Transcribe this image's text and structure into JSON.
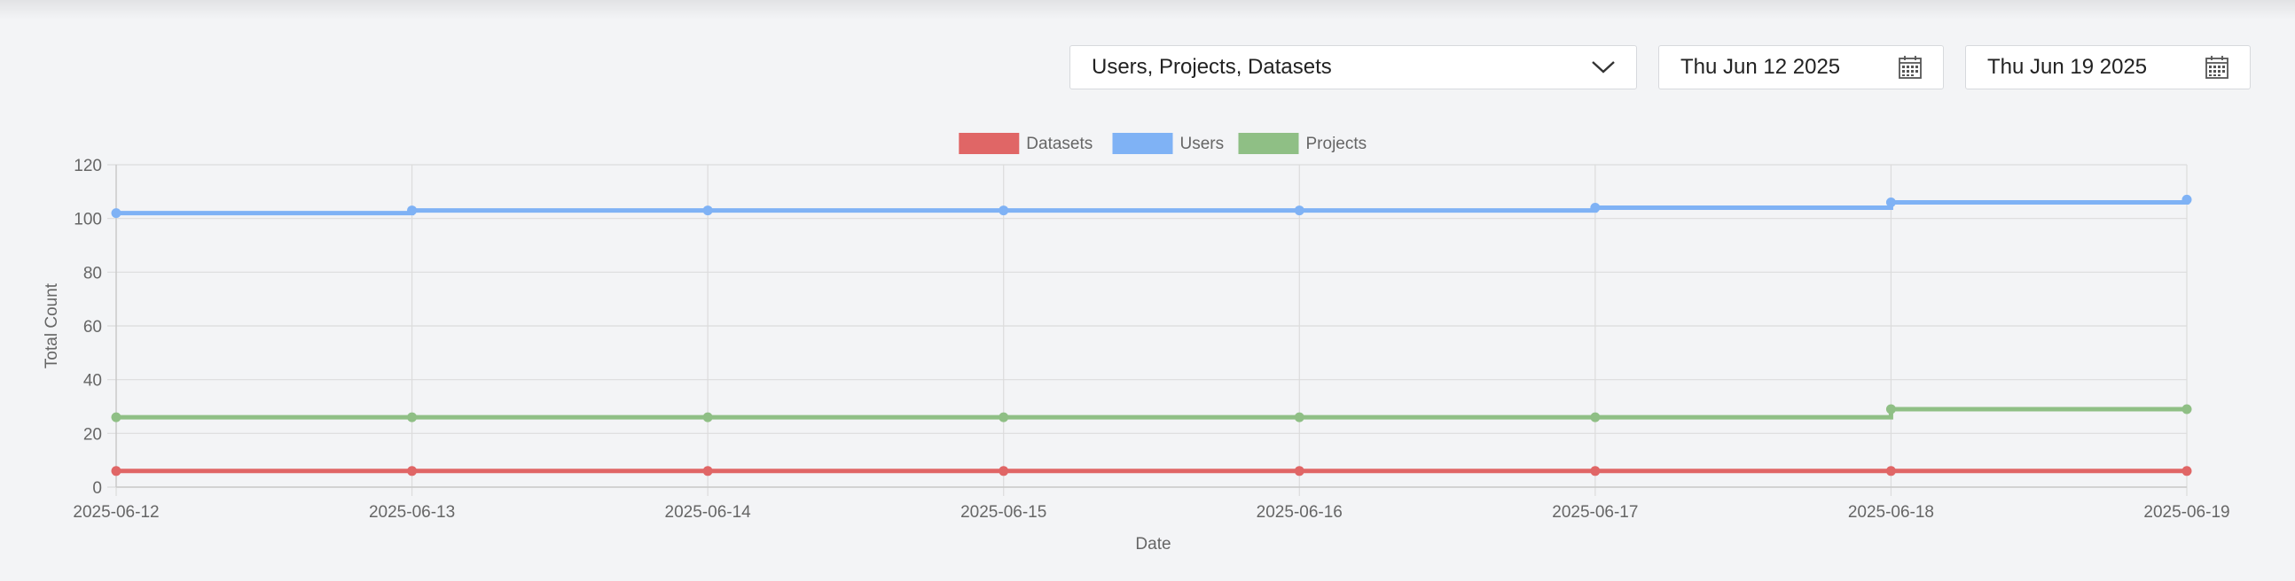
{
  "controls": {
    "series_select": {
      "value": "Users, Projects, Datasets"
    },
    "date_start": {
      "value": "Thu Jun 12 2025"
    },
    "date_end": {
      "value": "Thu Jun 19 2025"
    }
  },
  "chart_data": {
    "type": "line",
    "stepped": true,
    "x": [
      "2025-06-12",
      "2025-06-13",
      "2025-06-14",
      "2025-06-15",
      "2025-06-16",
      "2025-06-17",
      "2025-06-18",
      "2025-06-19"
    ],
    "xlabel": "Date",
    "ylabel": "Total Count",
    "ylim": [
      0,
      120
    ],
    "yticks": [
      0,
      20,
      40,
      60,
      80,
      100,
      120
    ],
    "grid": true,
    "legend_position": "top-center",
    "series": [
      {
        "name": "Datasets",
        "color": "#e06666",
        "values": [
          6,
          6,
          6,
          6,
          6,
          6,
          6,
          6
        ]
      },
      {
        "name": "Users",
        "color": "#7fb2f5",
        "values": [
          102,
          103,
          103,
          103,
          103,
          104,
          106,
          107
        ]
      },
      {
        "name": "Projects",
        "color": "#8fbf85",
        "values": [
          26,
          26,
          26,
          26,
          26,
          26,
          29,
          29
        ]
      }
    ]
  }
}
